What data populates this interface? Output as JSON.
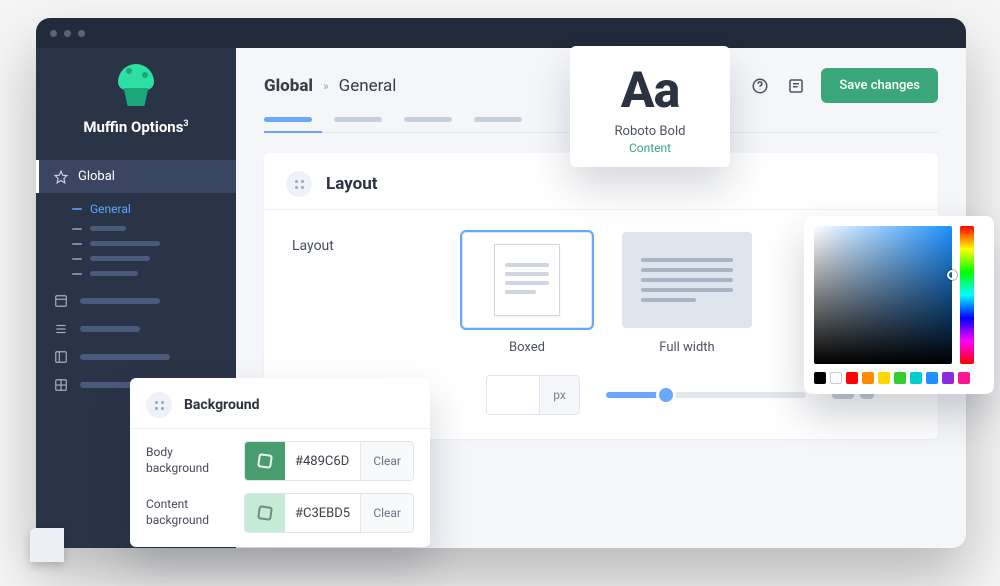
{
  "brand": {
    "name": "Muffin Options",
    "sup": "3"
  },
  "sidebar": {
    "global_label": "Global",
    "general_label": "General"
  },
  "breadcrumbs": {
    "root": "Global",
    "current": "General"
  },
  "actions": {
    "save": "Save changes"
  },
  "panel": {
    "layout_title": "Layout",
    "field_label": "Layout",
    "options": {
      "boxed": "Boxed",
      "full": "Full width"
    },
    "unit": "px",
    "input_value": ""
  },
  "font_card": {
    "sample": "Aa",
    "name": "Roboto Bold",
    "link": "Content"
  },
  "bg_card": {
    "title": "Background",
    "rows": [
      {
        "label": "Body background",
        "hex": "#489C6D",
        "clear": "Clear"
      },
      {
        "label": "Content background",
        "hex": "#C3EBD5",
        "clear": "Clear"
      }
    ]
  },
  "picker": {
    "swatches": [
      "#000000",
      "#ffffff",
      "#ff0000",
      "#ff8c00",
      "#ffd700",
      "#32cd32",
      "#00ced1",
      "#1e90ff",
      "#8a2be2",
      "#ff1493"
    ]
  }
}
